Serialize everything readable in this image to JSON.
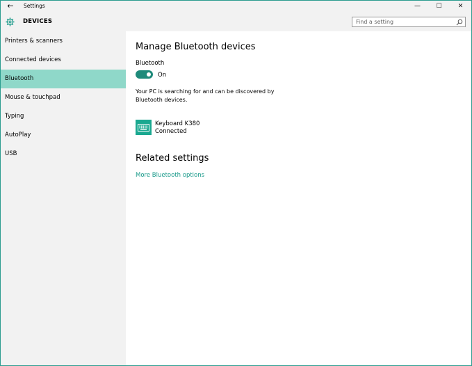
{
  "window": {
    "title": "Settings",
    "controls": [
      "—",
      "☐",
      "✕"
    ]
  },
  "header": {
    "title": "DEVICES",
    "search_placeholder": "Find a setting"
  },
  "sidebar": {
    "items": [
      {
        "label": "Printers & scanners",
        "active": false
      },
      {
        "label": "Connected devices",
        "active": false
      },
      {
        "label": "Bluetooth",
        "active": true
      },
      {
        "label": "Mouse & touchpad",
        "active": false
      },
      {
        "label": "Typing",
        "active": false
      },
      {
        "label": "AutoPlay",
        "active": false
      },
      {
        "label": "USB",
        "active": false
      }
    ]
  },
  "main": {
    "heading": "Manage Bluetooth devices",
    "bluetooth_label": "Bluetooth",
    "toggle_state": "On",
    "description": "Your PC is searching for and can be discovered by Bluetooth devices.",
    "device": {
      "name": "Keyboard K380",
      "status": "Connected",
      "icon": "keyboard-icon"
    },
    "related_heading": "Related settings",
    "related_link": "More Bluetooth options"
  },
  "colors": {
    "accent": "#1e8a7a",
    "active_nav": "#8fd8c9",
    "link": "#1a9a8a",
    "chrome": "#f2f2f2"
  }
}
